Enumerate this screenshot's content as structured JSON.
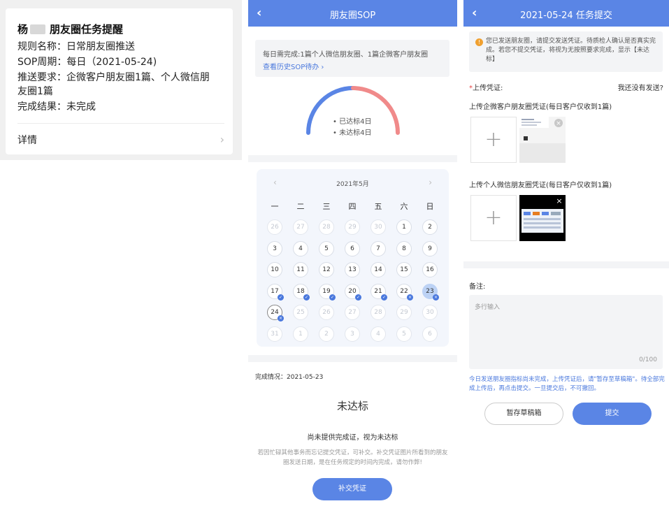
{
  "panel1": {
    "title_name": "杨",
    "title_text": "朋友圈任务提醒",
    "lines": [
      "规则名称：日常朋友圈推送",
      "SOP周期：每日（2021-05-24)",
      "推送要求：企微客户朋友圈1篇、个人微信朋",
      "友圈1篇",
      "完成结果：未完成"
    ],
    "detail_label": "详情",
    "chevron": "›"
  },
  "panel2": {
    "header": {
      "back": "‹",
      "title": "朋友圈SOP"
    },
    "tip_line": "每日需完成:1篇个人微信朋友圈、1篇企微客户朋友圈",
    "tip_link": "查看历史SOP待办 ›",
    "gauge": {
      "achieved_label": "• 已达标4日",
      "not_achieved_label": "• 未达标4日",
      "achieved_days": 4,
      "not_achieved_days": 4,
      "achieved_color": "#5a85e5",
      "not_achieved_color": "#f08a8a"
    },
    "calendar": {
      "month_label": "2021年5月",
      "prev": "‹",
      "next": "›",
      "weekdays": [
        "一",
        "二",
        "三",
        "四",
        "五",
        "六",
        "日"
      ],
      "days": [
        [
          "26",
          "27",
          "28",
          "29",
          "30",
          "1",
          "2"
        ],
        [
          "3",
          "4",
          "5",
          "6",
          "7",
          "8",
          "9"
        ],
        [
          "10",
          "11",
          "12",
          "13",
          "14",
          "15",
          "16"
        ],
        [
          "17",
          "18",
          "19",
          "20",
          "21",
          "22",
          "23"
        ],
        [
          "24",
          "25",
          "26",
          "27",
          "28",
          "29",
          "30"
        ],
        [
          "31",
          "1",
          "2",
          "3",
          "4",
          "5",
          "6"
        ]
      ]
    },
    "completion_label": "完成情况：2021-05-23",
    "status_big": "未达标",
    "msg1": "尚未提供完成证，视为未达标",
    "msg2": "若因忙碌其他事务而忘记提交凭证，可补交。补交凭证图片所看到的朋友圈发送日期，是在任务规定的时间内完成，请勿作弊!",
    "button": "补交凭证"
  },
  "panel3": {
    "header": {
      "back": "‹",
      "title": "2021-05-24 任务提交"
    },
    "warn_icon": "!",
    "warn_text": "您已发送朋友圈，请提交发送凭证。待质检人确认是否真实完成。若您不提交凭证，将视为无按照要求完成，显示【未达标】",
    "upload_required_mark": "*",
    "upload_label": "上传凭证:",
    "not_sent_link": "我还没有发送?",
    "wecom_label": "上传企微客户朋友圈凭证(每日客户仅收到1篇)",
    "wechat_label": "上传个人微信朋友圈凭证(每日客户仅收到1篇)",
    "plus": "+",
    "remove_icon": "×",
    "note_label": "备注:",
    "textarea_placeholder": "多行输入",
    "counter": "0/100",
    "notice": "今日发送朋友圈指标尚未完成，上传凭证后，请\"暂存至草稿箱\"。待全部完成上传后，再点击提交。一旦提交后，不可撤回。",
    "draft_button": "暂存草稿箱",
    "submit_button": "提交"
  }
}
